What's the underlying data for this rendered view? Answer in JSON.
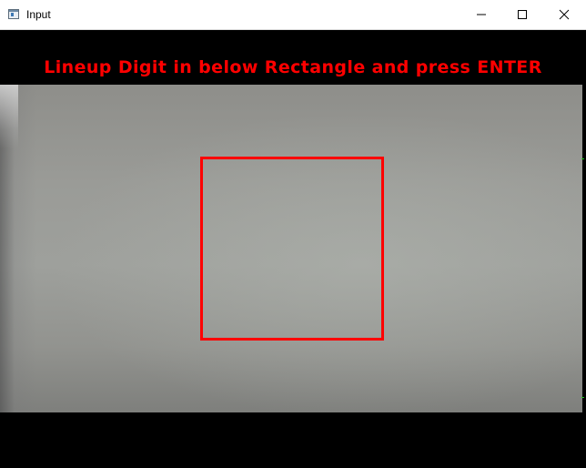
{
  "window": {
    "title": "Input",
    "icon": "app-window-icon",
    "controls": {
      "minimize_icon": "minimize-icon",
      "maximize_icon": "maximize-icon",
      "close_icon": "close-icon"
    }
  },
  "overlay": {
    "instruction": "Lineup Digit in below Rectangle and press ENTER",
    "text_color": "#ff0000",
    "rect_color": "#ff0000"
  },
  "colors": {
    "background": "#000000",
    "titlebar": "#ffffff"
  }
}
